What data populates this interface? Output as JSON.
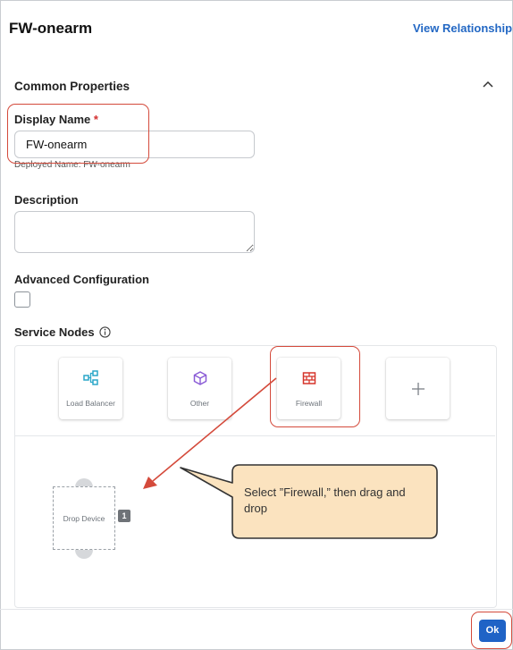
{
  "header": {
    "title": "FW-onearm",
    "view_relationship": "View Relationship"
  },
  "section": {
    "title": "Common Properties",
    "collapse_icon": "chevron-up-icon"
  },
  "display_name": {
    "label": "Display Name",
    "required_mark": "*",
    "value": "FW-onearm",
    "helper": "Deployed Name: FW-onearm"
  },
  "description": {
    "label": "Description",
    "value": ""
  },
  "advanced": {
    "label": "Advanced Configuration",
    "checked": false
  },
  "service_nodes": {
    "label": "Service Nodes",
    "info_icon": "info-icon",
    "tiles": [
      {
        "label": "Load Balancer",
        "icon": "load-balancer-icon",
        "color": "#2aa7c9"
      },
      {
        "label": "Other",
        "icon": "cube-icon",
        "color": "#8a5bd6"
      },
      {
        "label": "Firewall",
        "icon": "firewall-icon",
        "color": "#d6352b"
      },
      {
        "label": "",
        "icon": "plus-icon",
        "color": "#7b8087"
      }
    ],
    "drop_device": {
      "label": "Drop Device",
      "badge": "1"
    }
  },
  "callout": {
    "text": "Select ”Firewall,” then drag and drop",
    "color": "#fbe3bf"
  },
  "annotation_color": "#d44a3b",
  "footer": {
    "ok_label": "Ok",
    "ok_color": "#1f63c6"
  }
}
